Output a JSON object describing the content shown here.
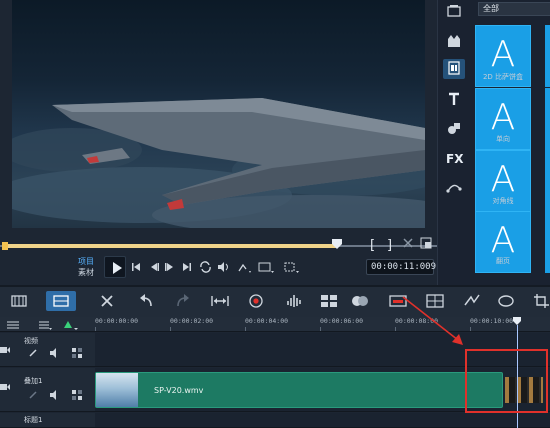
{
  "player": {
    "mode_project": "项目",
    "mode_clip": "素材",
    "timecode": "00:00:11:009"
  },
  "library": {
    "dropdown": "全部",
    "items": [
      {
        "label": "2D 比萨饼盒"
      },
      {
        "label": "单向"
      },
      {
        "label": "对角线"
      },
      {
        "label": "翻页"
      }
    ],
    "thumb_glyph": "A"
  },
  "timeline": {
    "ruler": [
      "00:00:00:00",
      "00:00:02:00",
      "00:00:04:00",
      "00:00:06:00",
      "00:00:08:00",
      "00:00:10:00"
    ],
    "tracks": [
      {
        "name": "视频"
      },
      {
        "name": "叠加1"
      },
      {
        "name": "标题1"
      }
    ],
    "clip_name": "SP-V20.wmv"
  },
  "colors": {
    "accent": "#1a9fe6",
    "clip": "#1d7a63",
    "annotation": "#e0312b",
    "mode_active": "#58b3ff"
  },
  "icons": {
    "rail": [
      "media-icon",
      "instant-project-icon",
      "transition-icon",
      "title-icon",
      "graphic-icon",
      "fx-filter-icon",
      "path-icon"
    ],
    "toolbar": [
      "storyboard-view-icon",
      "timeline-view-icon",
      "tools-icon",
      "undo-icon",
      "redo-icon",
      "fit-icon",
      "record-capture-icon",
      "sound-mixer-icon",
      "multi-camera-icon",
      "subtitle-icon",
      "title-safe-icon",
      "grid-icon",
      "motion-icon",
      "path-icon",
      "crop-icon"
    ]
  }
}
